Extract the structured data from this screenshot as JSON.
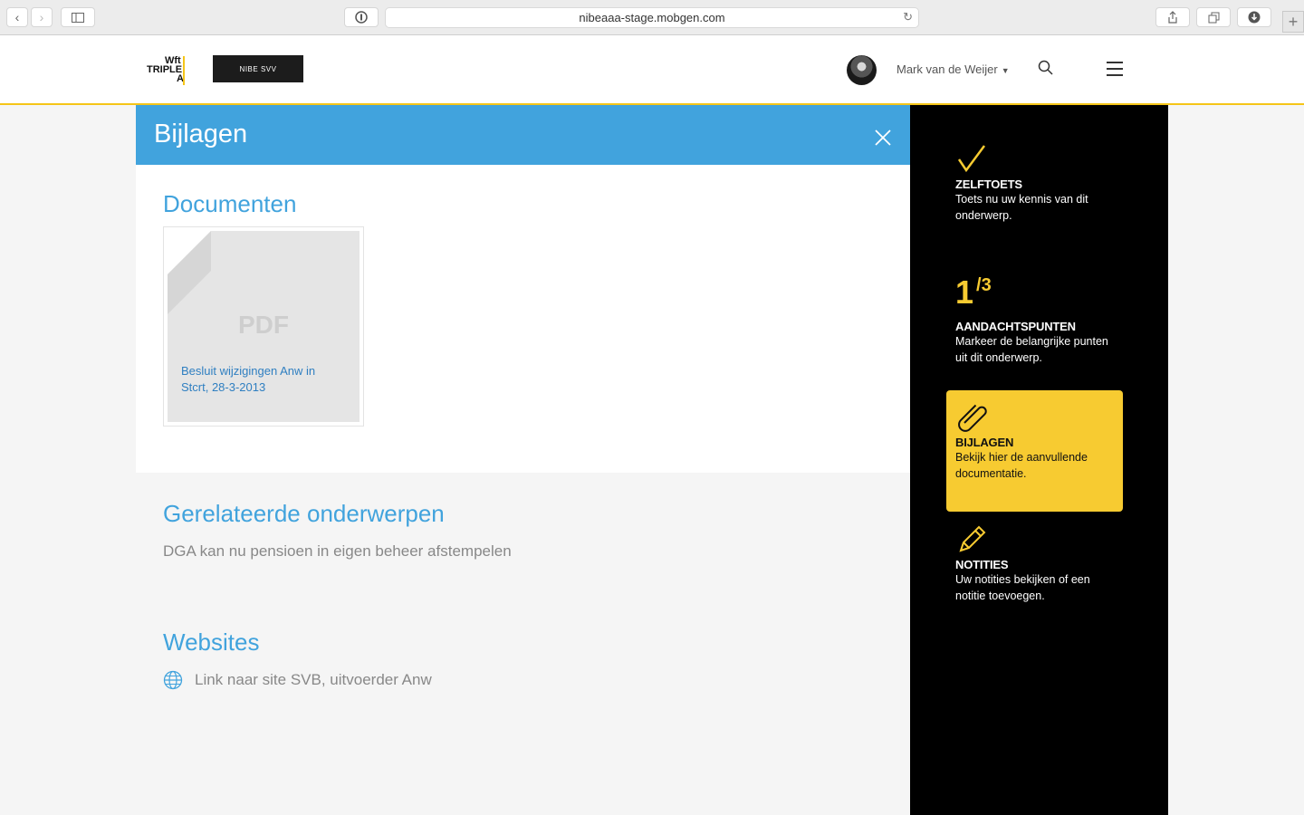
{
  "browser": {
    "url": "nibeaaa-stage.mobgen.com"
  },
  "header": {
    "logo_wft": "Wft TRIPLE A",
    "logo_nibe": "NIBE SVV",
    "username": "Mark van de Weijer"
  },
  "panel": {
    "title": "Bijlagen",
    "documents": {
      "heading": "Documenten",
      "items": [
        {
          "type_label": "PDF",
          "title": "Besluit wijzigingen Anw in Stcrt, 28-3-2013"
        }
      ]
    },
    "related": {
      "heading": "Gerelateerde onderwerpen",
      "items": [
        "DGA kan nu pensioen in eigen beheer afstempelen"
      ]
    },
    "websites": {
      "heading": "Websites",
      "items": [
        "Link naar site SVB, uitvoerder Anw"
      ]
    }
  },
  "sidebar": {
    "items": [
      {
        "icon": "checkmark-icon",
        "title": "ZELFTOETS",
        "desc": "Toets nu uw kennis van dit onderwerp."
      },
      {
        "counter_current": "1",
        "counter_total": "/3",
        "title": "AANDACHTSPUNTEN",
        "desc": "Markeer de belangrijke punten uit dit onderwerp."
      },
      {
        "icon": "paperclip-icon",
        "title": "BIJLAGEN",
        "desc": "Bekijk hier de aanvullende documentatie.",
        "active": true
      },
      {
        "icon": "pencil-icon",
        "title": "NOTITIES",
        "desc": "Uw notities bekijken of een notitie toevoegen."
      }
    ]
  },
  "colors": {
    "accent_blue": "#41a3dd",
    "accent_yellow": "#f7cb31",
    "sidebar_bg": "#000000"
  }
}
